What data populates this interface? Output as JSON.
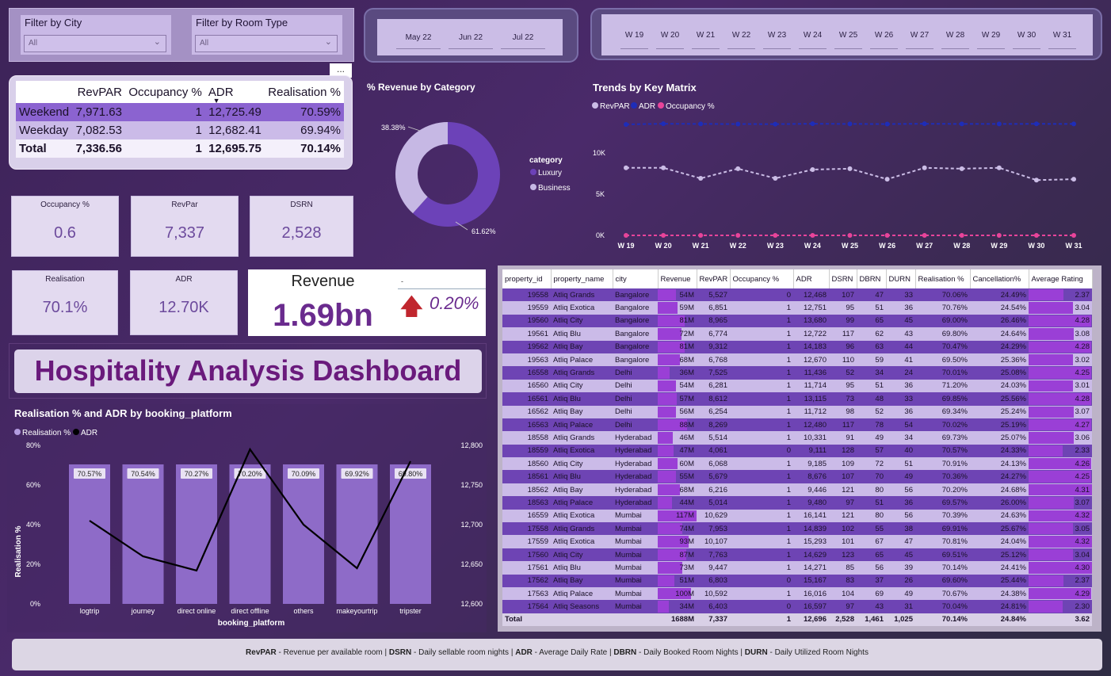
{
  "filters": {
    "city": {
      "label": "Filter by City",
      "value": "All"
    },
    "room_type": {
      "label": "Filter by Room Type",
      "value": "All"
    }
  },
  "months": [
    "May 22",
    "Jun 22",
    "Jul 22"
  ],
  "weeks": [
    "W 19",
    "W 20",
    "W 21",
    "W 22",
    "W 23",
    "W 24",
    "W 25",
    "W 26",
    "W 27",
    "W 28",
    "W 29",
    "W 30",
    "W 31"
  ],
  "summary_matrix": {
    "more_label": "...",
    "headers": [
      "",
      "RevPAR",
      "Occupancy %",
      "ADR",
      "Realisation %"
    ],
    "rows": [
      [
        "Weekend",
        "7,971.63",
        "1",
        "12,725.49",
        "70.59%"
      ],
      [
        "Weekday",
        "7,082.53",
        "1",
        "12,682.41",
        "69.94%"
      ]
    ],
    "total": [
      "Total",
      "7,336.56",
      "1",
      "12,695.75",
      "70.14%"
    ]
  },
  "kpis": {
    "occupancy": {
      "title": "Occupancy %",
      "value": "0.6"
    },
    "revpar": {
      "title": "RevPar",
      "value": "7,337"
    },
    "dsrn": {
      "title": "DSRN",
      "value": "2,528"
    },
    "realisation": {
      "title": "Realisation",
      "value": "70.1%"
    },
    "adr": {
      "title": "ADR",
      "value": "12.70K"
    }
  },
  "revenue_card": {
    "title": "Revenue",
    "value": "1.69bn",
    "change": "0.20%",
    "marker": "-"
  },
  "dashboard_title": "Hospitality Analysis Dashboard",
  "colors": {
    "accent": "#8b63d0",
    "title": "#6a1a7c",
    "revpar": "#cbbde6",
    "adr": "#1e2db8",
    "occupancy": "#e8449a",
    "bar": "#8e6bc8"
  },
  "donut": {
    "title": "% Revenue by Category",
    "legend_title": "category",
    "slices": [
      {
        "name": "Luxury",
        "pct": 61.62,
        "label": "61.62%",
        "color": "#6c42b8"
      },
      {
        "name": "Business",
        "pct": 38.38,
        "label": "38.38%",
        "color": "#c6b8e4"
      }
    ]
  },
  "trend_chart": {
    "type": "line",
    "title": "Trends by Key Matrix",
    "x": [
      "W 19",
      "W 20",
      "W 21",
      "W 22",
      "W 23",
      "W 24",
      "W 25",
      "W 26",
      "W 27",
      "W 28",
      "W 29",
      "W 30",
      "W 31"
    ],
    "y_ticks": [
      "10K",
      "5K",
      "0K"
    ],
    "ylim": [
      0,
      14000
    ],
    "series": [
      {
        "name": "RevPAR",
        "color": "#cbbde6",
        "values": [
          7700,
          7700,
          6500,
          7600,
          6500,
          7500,
          7600,
          6400,
          7700,
          7600,
          7700,
          6300,
          6400
        ]
      },
      {
        "name": "ADR",
        "color": "#1e2db8",
        "values": [
          12650,
          12720,
          12700,
          12690,
          12680,
          12720,
          12700,
          12690,
          12720,
          12700,
          12700,
          12710,
          12700
        ]
      },
      {
        "name": "Occupancy %",
        "color": "#e8449a",
        "values": [
          1,
          1,
          1,
          1,
          1,
          1,
          1,
          1,
          1,
          1,
          1,
          1,
          1
        ]
      }
    ]
  },
  "bar_chart": {
    "type": "bar",
    "title": "Realisation % and ADR by booking_platform",
    "legend": [
      "Realisation %",
      "ADR"
    ],
    "xlabel": "booking_platform",
    "ylabel": "Realisation %",
    "categories": [
      "logtrip",
      "journey",
      "direct online",
      "direct offline",
      "others",
      "makeyourtrip",
      "tripster"
    ],
    "realisation": [
      70.57,
      70.54,
      70.27,
      70.2,
      70.09,
      69.92,
      69.8
    ],
    "realisation_labels": [
      "70.57%",
      "70.54%",
      "70.27%",
      "70.20%",
      "70.09%",
      "69.92%",
      "69.80%"
    ],
    "adr": [
      12705,
      12660,
      12642,
      12795,
      12700,
      12645,
      12780
    ],
    "ylim_left": [
      0,
      80
    ],
    "left_ticks": [
      "80%",
      "60%",
      "40%",
      "20%",
      "0%"
    ],
    "ylim_right": [
      12600,
      12800
    ],
    "right_ticks": [
      "12,800",
      "12,750",
      "12,700",
      "12,650",
      "12,600"
    ]
  },
  "data_table": {
    "headers": [
      "property_id",
      "property_name",
      "city",
      "Revenue",
      "RevPAR",
      "Occupancy %",
      "ADR",
      "DSRN",
      "DBRN",
      "DURN",
      "Realisation %",
      "Cancellation%",
      "Average Rating"
    ],
    "rows": [
      [
        "19558",
        "Atliq Grands",
        "Bangalore",
        "54M",
        54,
        "5,527",
        "0",
        "12,468",
        "107",
        "47",
        "33",
        "70.06%",
        "24.49%",
        "2.37",
        2.37
      ],
      [
        "19559",
        "Atliq Exotica",
        "Bangalore",
        "59M",
        59,
        "6,851",
        "1",
        "12,751",
        "95",
        "51",
        "36",
        "70.76%",
        "24.54%",
        "3.04",
        3.04
      ],
      [
        "19560",
        "Atliq City",
        "Bangalore",
        "81M",
        81,
        "8,965",
        "1",
        "13,680",
        "99",
        "65",
        "45",
        "69.00%",
        "26.46%",
        "4.28",
        4.28
      ],
      [
        "19561",
        "Atliq Blu",
        "Bangalore",
        "72M",
        72,
        "6,774",
        "1",
        "12,722",
        "117",
        "62",
        "43",
        "69.80%",
        "24.64%",
        "3.08",
        3.08
      ],
      [
        "19562",
        "Atliq Bay",
        "Bangalore",
        "81M",
        81,
        "9,312",
        "1",
        "14,183",
        "96",
        "63",
        "44",
        "70.47%",
        "24.29%",
        "4.28",
        4.28
      ],
      [
        "19563",
        "Atliq Palace",
        "Bangalore",
        "68M",
        68,
        "6,768",
        "1",
        "12,670",
        "110",
        "59",
        "41",
        "69.50%",
        "25.36%",
        "3.02",
        3.02
      ],
      [
        "16558",
        "Atliq Grands",
        "Delhi",
        "36M",
        36,
        "7,525",
        "1",
        "11,436",
        "52",
        "34",
        "24",
        "70.01%",
        "25.08%",
        "4.25",
        4.25
      ],
      [
        "16560",
        "Atliq City",
        "Delhi",
        "54M",
        54,
        "6,281",
        "1",
        "11,714",
        "95",
        "51",
        "36",
        "71.20%",
        "24.03%",
        "3.01",
        3.01
      ],
      [
        "16561",
        "Atliq Blu",
        "Delhi",
        "57M",
        57,
        "8,612",
        "1",
        "13,115",
        "73",
        "48",
        "33",
        "69.85%",
        "25.56%",
        "4.28",
        4.28
      ],
      [
        "16562",
        "Atliq Bay",
        "Delhi",
        "56M",
        56,
        "6,254",
        "1",
        "11,712",
        "98",
        "52",
        "36",
        "69.34%",
        "25.24%",
        "3.07",
        3.07
      ],
      [
        "16563",
        "Atliq Palace",
        "Delhi",
        "88M",
        88,
        "8,269",
        "1",
        "12,480",
        "117",
        "78",
        "54",
        "70.02%",
        "25.19%",
        "4.27",
        4.27
      ],
      [
        "18558",
        "Atliq Grands",
        "Hyderabad",
        "46M",
        46,
        "5,514",
        "1",
        "10,331",
        "91",
        "49",
        "34",
        "69.73%",
        "25.07%",
        "3.06",
        3.06
      ],
      [
        "18559",
        "Atliq Exotica",
        "Hyderabad",
        "47M",
        47,
        "4,061",
        "0",
        "9,111",
        "128",
        "57",
        "40",
        "70.57%",
        "24.33%",
        "2.33",
        2.33
      ],
      [
        "18560",
        "Atliq City",
        "Hyderabad",
        "60M",
        60,
        "6,068",
        "1",
        "9,185",
        "109",
        "72",
        "51",
        "70.91%",
        "24.13%",
        "4.26",
        4.26
      ],
      [
        "18561",
        "Atliq Blu",
        "Hyderabad",
        "55M",
        55,
        "5,679",
        "1",
        "8,676",
        "107",
        "70",
        "49",
        "70.36%",
        "24.27%",
        "4.25",
        4.25
      ],
      [
        "18562",
        "Atliq Bay",
        "Hyderabad",
        "68M",
        68,
        "6,216",
        "1",
        "9,446",
        "121",
        "80",
        "56",
        "70.20%",
        "24.68%",
        "4.31",
        4.31
      ],
      [
        "18563",
        "Atliq Palace",
        "Hyderabad",
        "44M",
        44,
        "5,014",
        "1",
        "9,480",
        "97",
        "51",
        "36",
        "69.57%",
        "26.00%",
        "3.07",
        3.07
      ],
      [
        "16559",
        "Atliq Exotica",
        "Mumbai",
        "117M",
        117,
        "10,629",
        "1",
        "16,141",
        "121",
        "80",
        "56",
        "70.39%",
        "24.63%",
        "4.32",
        4.32
      ],
      [
        "17558",
        "Atliq Grands",
        "Mumbai",
        "74M",
        74,
        "7,953",
        "1",
        "14,839",
        "102",
        "55",
        "38",
        "69.91%",
        "25.67%",
        "3.05",
        3.05
      ],
      [
        "17559",
        "Atliq Exotica",
        "Mumbai",
        "93M",
        93,
        "10,107",
        "1",
        "15,293",
        "101",
        "67",
        "47",
        "70.81%",
        "24.04%",
        "4.32",
        4.32
      ],
      [
        "17560",
        "Atliq City",
        "Mumbai",
        "87M",
        87,
        "7,763",
        "1",
        "14,629",
        "123",
        "65",
        "45",
        "69.51%",
        "25.12%",
        "3.04",
        3.04
      ],
      [
        "17561",
        "Atliq Blu",
        "Mumbai",
        "73M",
        73,
        "9,447",
        "1",
        "14,271",
        "85",
        "56",
        "39",
        "70.14%",
        "24.41%",
        "4.30",
        4.3
      ],
      [
        "17562",
        "Atliq Bay",
        "Mumbai",
        "51M",
        51,
        "6,803",
        "0",
        "15,167",
        "83",
        "37",
        "26",
        "69.60%",
        "25.44%",
        "2.37",
        2.37
      ],
      [
        "17563",
        "Atliq Palace",
        "Mumbai",
        "100M",
        100,
        "10,592",
        "1",
        "16,016",
        "104",
        "69",
        "49",
        "70.67%",
        "24.38%",
        "4.29",
        4.29
      ],
      [
        "17564",
        "Atliq Seasons",
        "Mumbai",
        "34M",
        34,
        "6,403",
        "0",
        "16,597",
        "97",
        "43",
        "31",
        "70.04%",
        "24.81%",
        "2.30",
        2.3
      ]
    ],
    "total": [
      "Total",
      "",
      "",
      "1688M",
      "7,337",
      "1",
      "12,696",
      "2,528",
      "1,461",
      "1,025",
      "70.14%",
      "24.84%",
      "3.62"
    ]
  },
  "footer": {
    "parts": [
      {
        "b": "RevPAR",
        "t": " - Revenue per available room | "
      },
      {
        "b": "DSRN",
        "t": " - Daily sellable room nights | "
      },
      {
        "b": "ADR",
        "t": " - Average Daily Rate | "
      },
      {
        "b": "DBRN",
        "t": " - Daily Booked Room Nights | "
      },
      {
        "b": "DURN",
        "t": " - Daily Utilized Room Nights"
      }
    ]
  }
}
